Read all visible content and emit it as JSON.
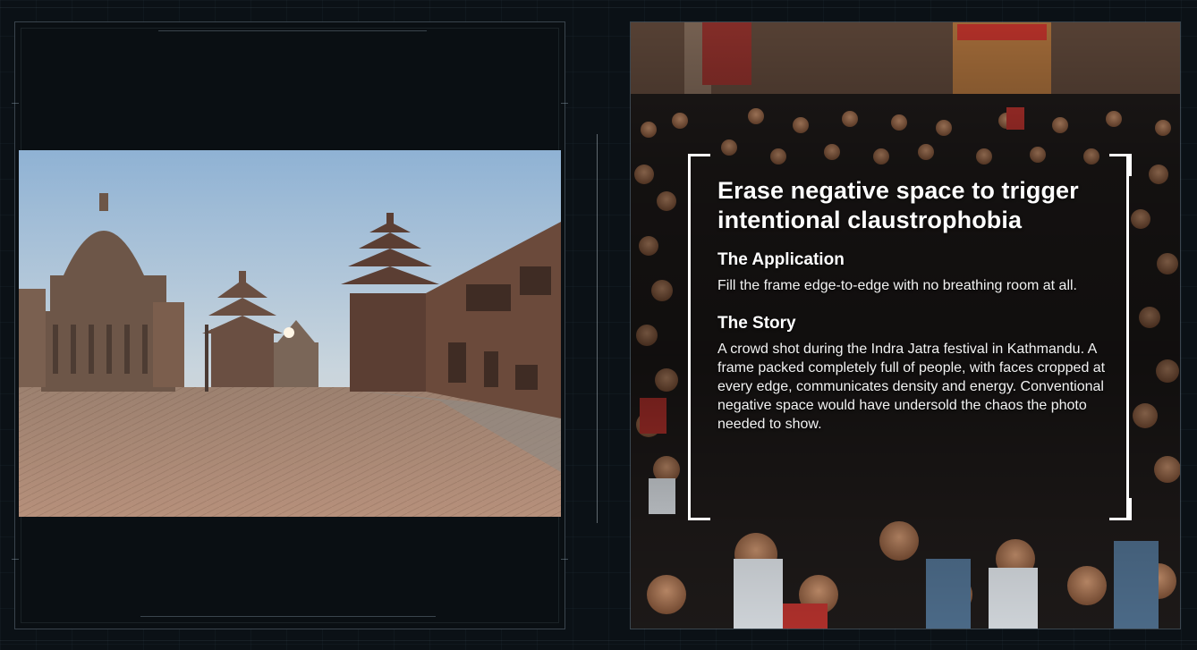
{
  "slide": {
    "headline": "Erase negative space to trigger intentional claustrophobia",
    "application": {
      "title": "The Application",
      "body": "Fill the frame edge-to-edge with no breathing room at all."
    },
    "story": {
      "title": "The Story",
      "body": "A crowd shot during the Indra Jatra festival in Kathmandu. A frame packed completely full of people, with faces cropped at every edge, communicates density and energy. Conventional negative space would have undersold the chaos the photo needed to show."
    }
  },
  "colors": {
    "background": "#0b1116",
    "frame_line": "#96aab9",
    "text": "#ffffff"
  },
  "images": {
    "left_photo": "temple-square-photo",
    "right_photo": "festival-crowd-photo"
  }
}
